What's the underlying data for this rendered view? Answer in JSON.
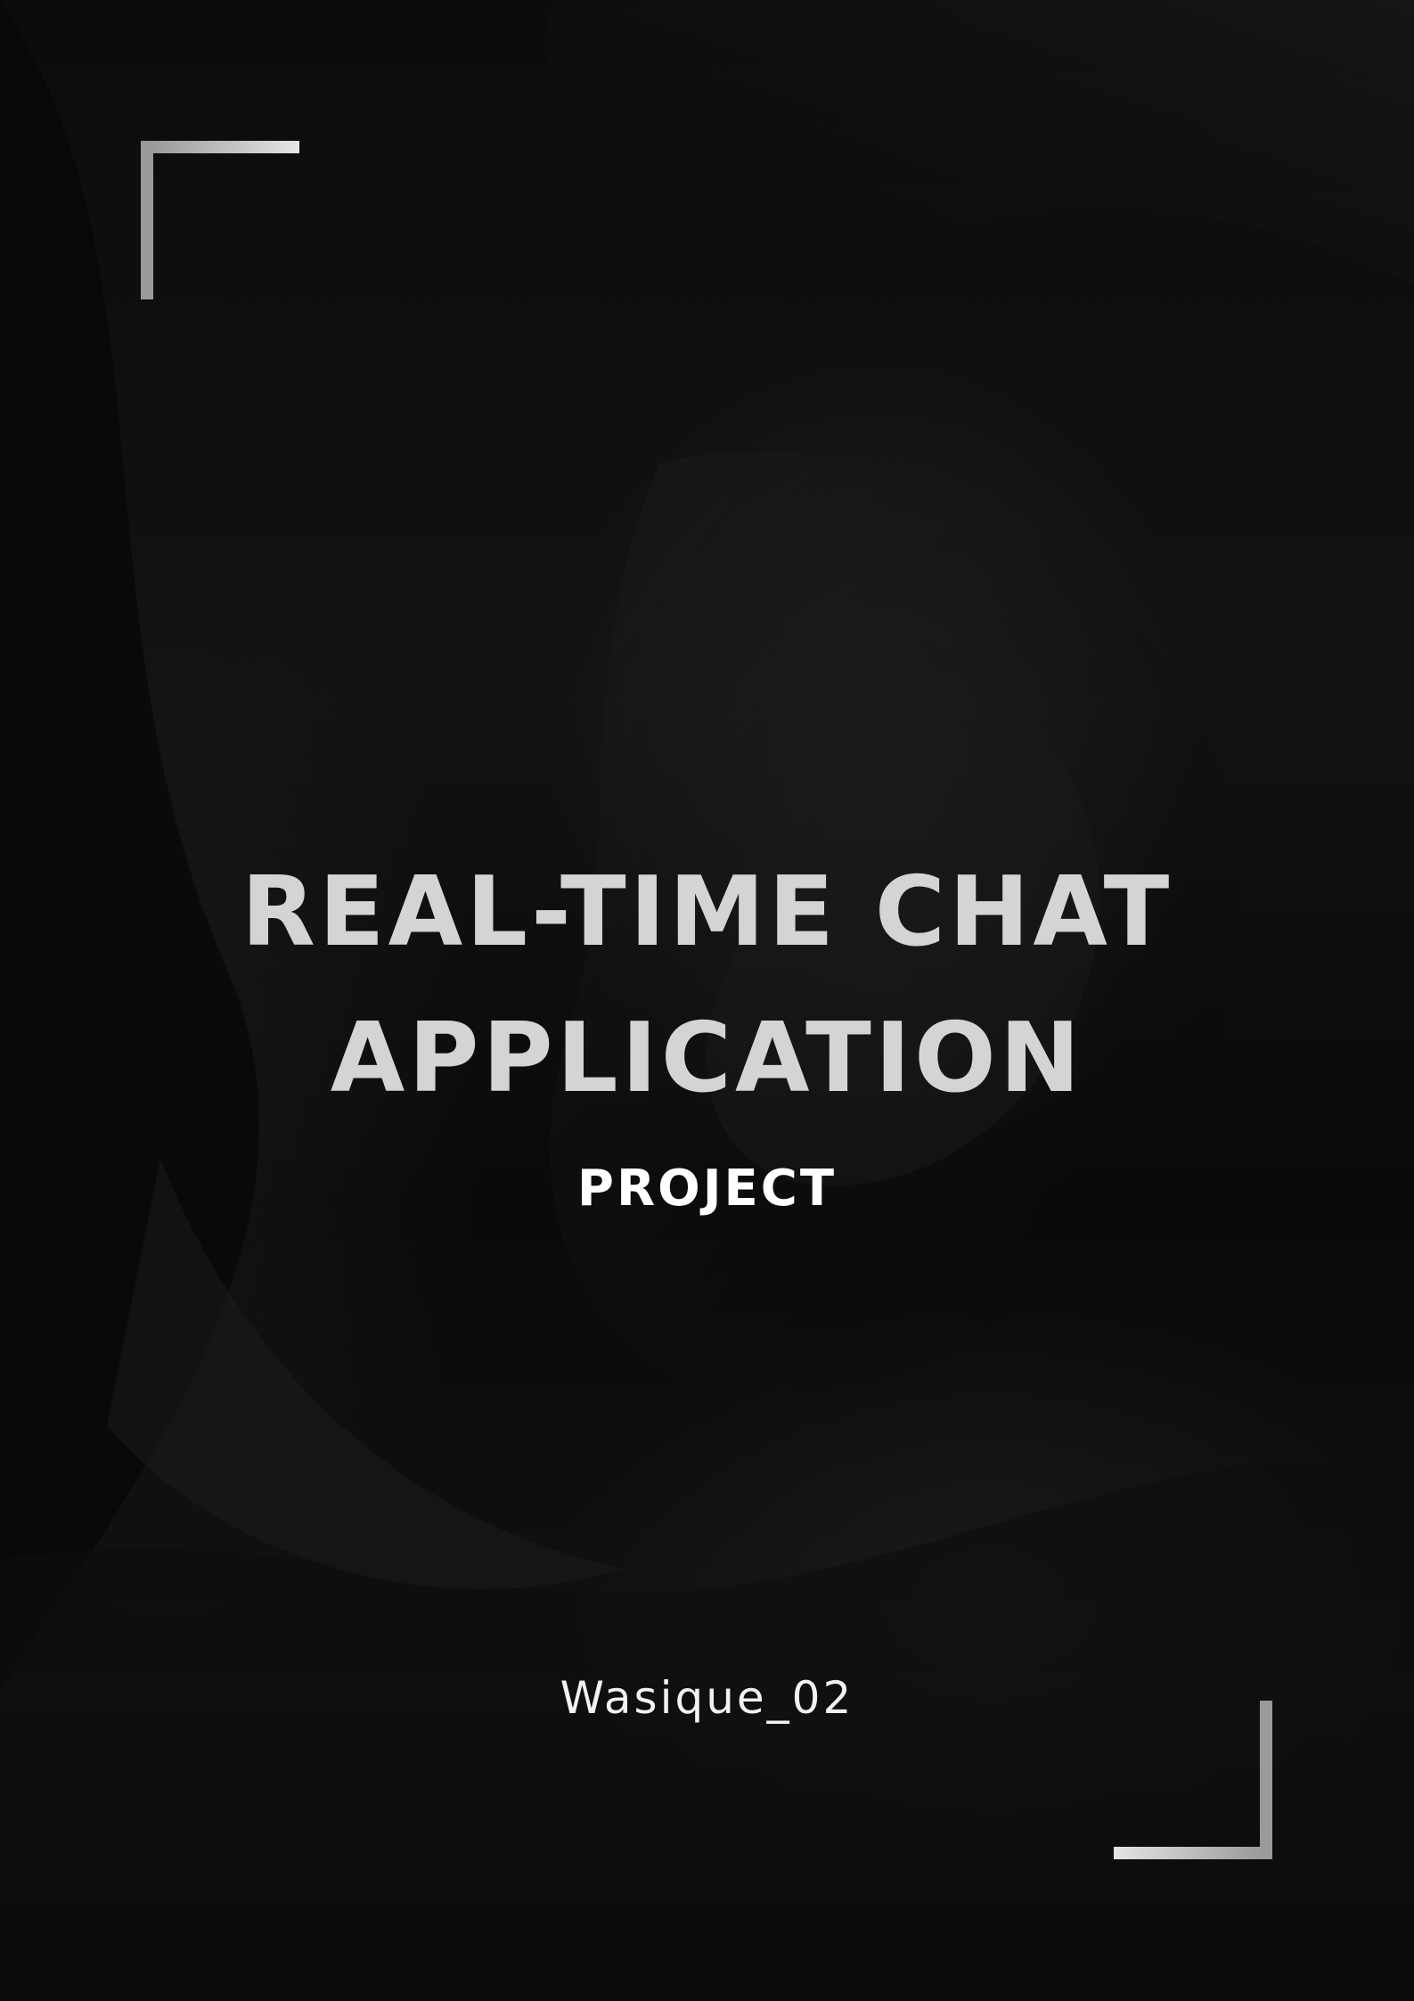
{
  "cover": {
    "title_line1": "REAL-TIME CHAT",
    "title_line2": "APPLICATION",
    "subtitle": "PROJECT",
    "author": "Wasique_02"
  },
  "colors": {
    "background": "#0a0a0a",
    "title": "#d4d4d4",
    "subtitle": "#ffffff",
    "frame_corners": "#bdbdbd"
  }
}
